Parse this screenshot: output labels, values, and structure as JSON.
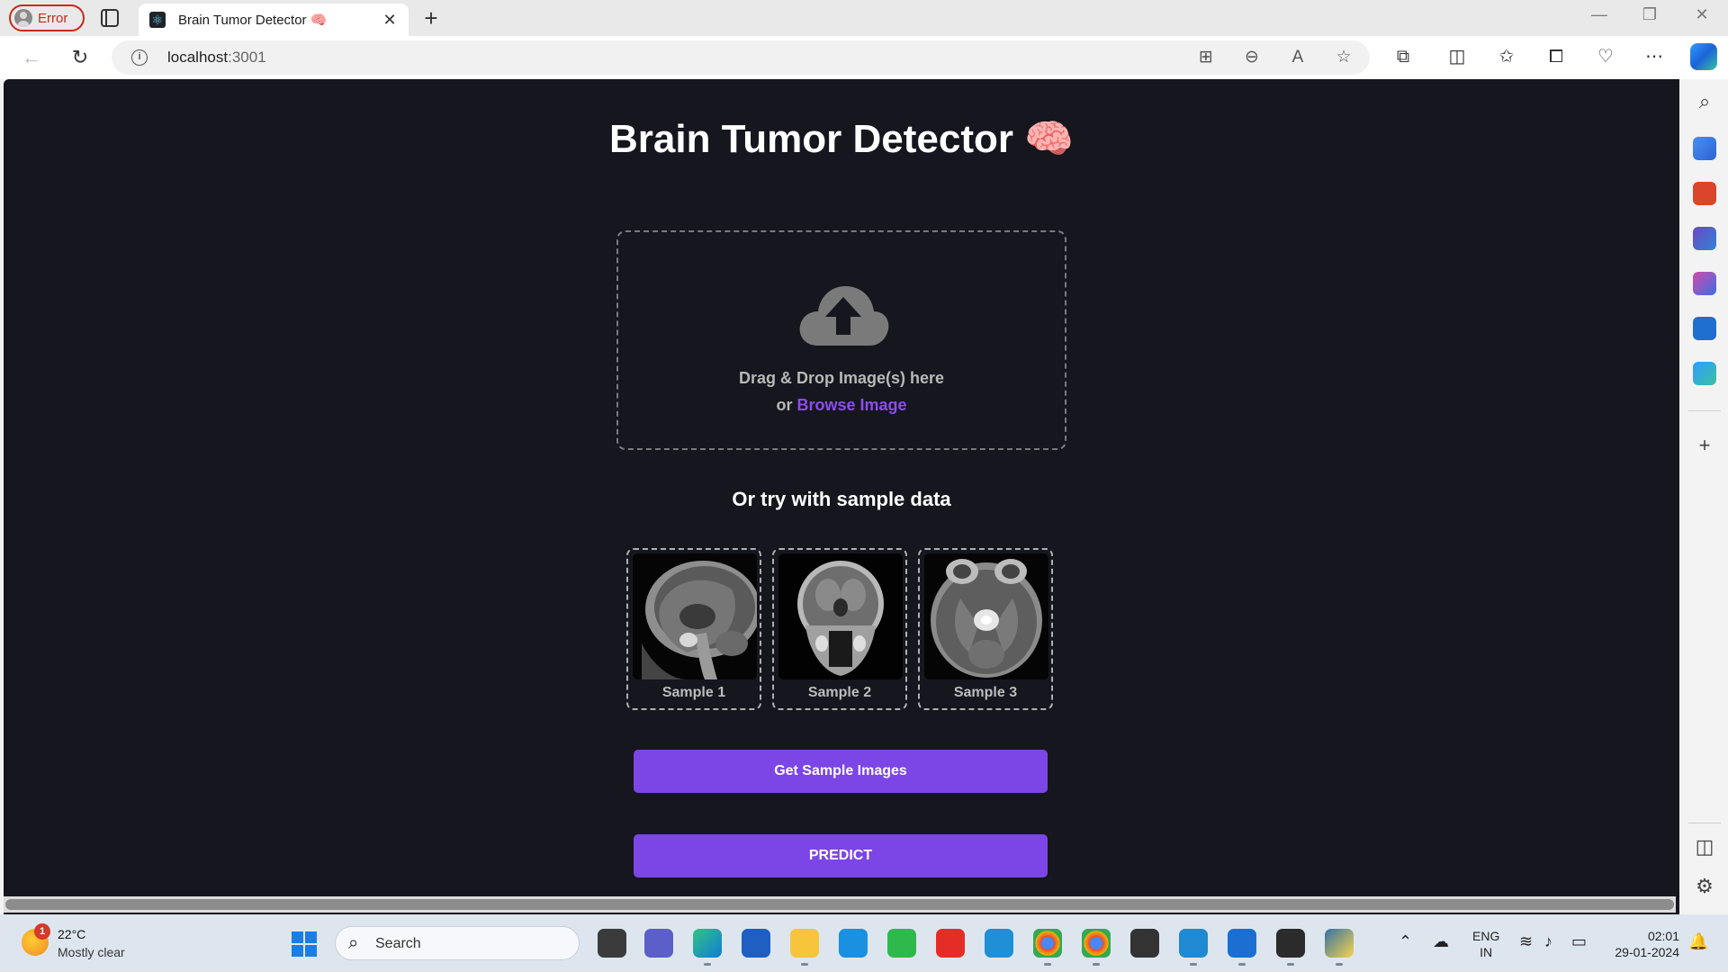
{
  "browser": {
    "profile_label": "Error",
    "tab_title": "Brain Tumor Detector 🧠",
    "new_tab_glyph": "+",
    "close_glyph": "✕",
    "url_host": "localhost",
    "url_port": ":3001"
  },
  "page": {
    "title": "Brain Tumor Detector",
    "title_emoji": "🧠",
    "dropzone": {
      "instruction": "Drag & Drop Image(s) here",
      "or_text": "or",
      "browse_label": "Browse Image",
      "icon": "cloud-upload-icon"
    },
    "sample_heading": "Or try with sample data",
    "samples": [
      {
        "label": "Sample 1",
        "view": "sagittal"
      },
      {
        "label": "Sample 2",
        "view": "coronal"
      },
      {
        "label": "Sample 3",
        "view": "axial"
      }
    ],
    "get_samples_label": "Get Sample Images",
    "predict_label": "PREDICT",
    "colors": {
      "background": "#15161e",
      "accent": "#7c45e6",
      "link": "#8d4cf0"
    }
  },
  "taskbar": {
    "temperature": "22°C",
    "weather": "Mostly clear",
    "weather_badge": "1",
    "search_label": "Search",
    "lang_line1": "ENG",
    "lang_line2": "IN",
    "time": "02:01",
    "date": "29-01-2024"
  }
}
